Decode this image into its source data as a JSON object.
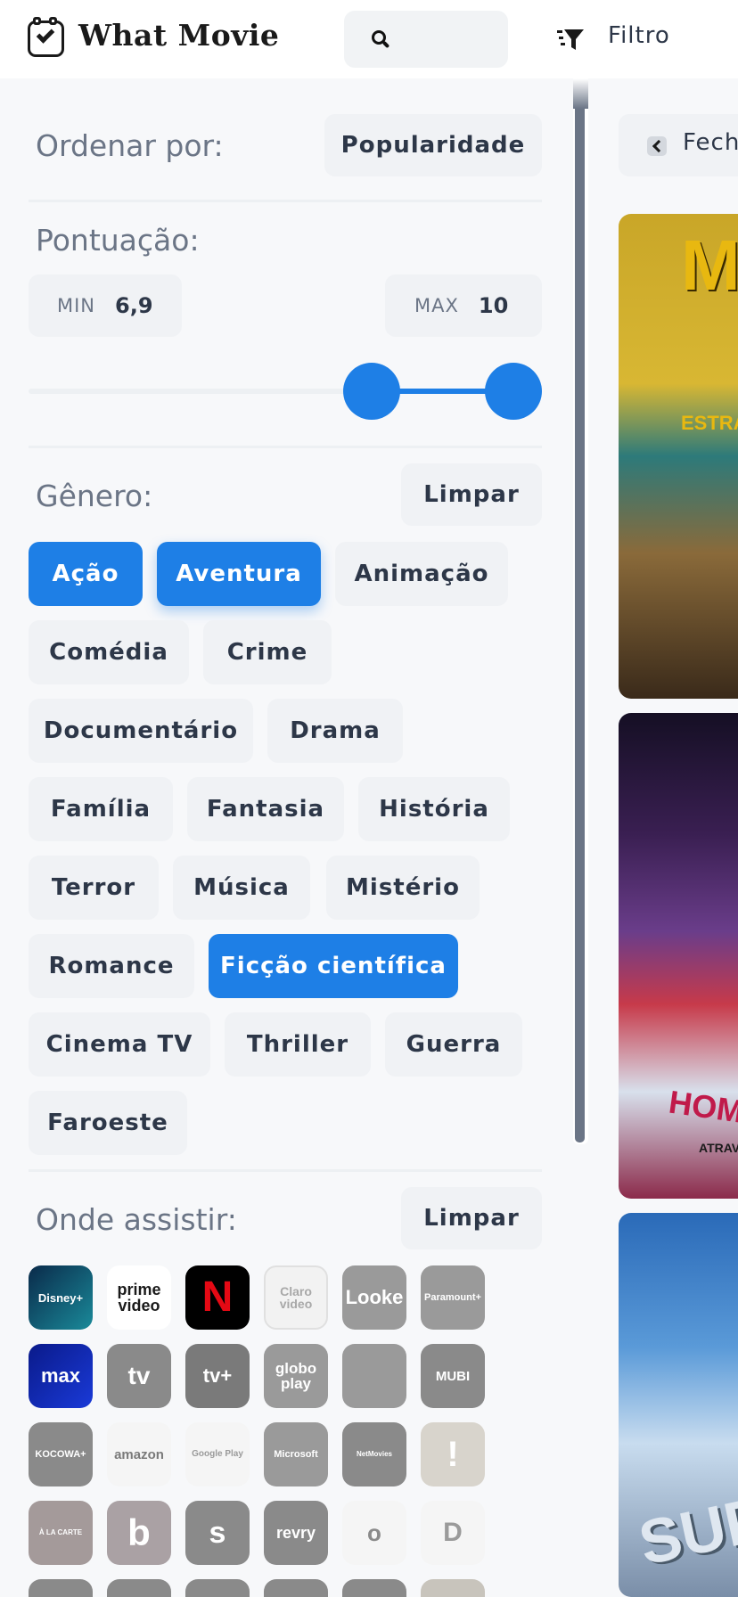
{
  "header": {
    "app_title": "What Movie",
    "filter_label": "Filtro"
  },
  "sort": {
    "label": "Ordenar por:",
    "selected": "Popularidade"
  },
  "score": {
    "label": "Pontuação:",
    "min_label": "MIN",
    "min_value": "6,9",
    "max_label": "MAX",
    "max_value": "10",
    "slider_min": 6.9,
    "slider_max": 10,
    "slider_scale_max": 10
  },
  "genre": {
    "label": "Gênero:",
    "clear_label": "Limpar",
    "items": [
      {
        "label": "Ação",
        "selected": true
      },
      {
        "label": "Aventura",
        "selected": true
      },
      {
        "label": "Animação",
        "selected": false
      },
      {
        "label": "Comédia",
        "selected": false
      },
      {
        "label": "Crime",
        "selected": false
      },
      {
        "label": "Documentário",
        "selected": false
      },
      {
        "label": "Drama",
        "selected": false
      },
      {
        "label": "Família",
        "selected": false
      },
      {
        "label": "Fantasia",
        "selected": false
      },
      {
        "label": "História",
        "selected": false
      },
      {
        "label": "Terror",
        "selected": false
      },
      {
        "label": "Música",
        "selected": false
      },
      {
        "label": "Mistério",
        "selected": false
      },
      {
        "label": "Romance",
        "selected": false
      },
      {
        "label": "Ficção científica",
        "selected": true
      },
      {
        "label": "Cinema TV",
        "selected": false
      },
      {
        "label": "Thriller",
        "selected": false
      },
      {
        "label": "Guerra",
        "selected": false
      },
      {
        "label": "Faroeste",
        "selected": false
      }
    ]
  },
  "providers": {
    "label": "Onde assistir:",
    "clear_label": "Limpar",
    "items": [
      {
        "name": "disney-plus",
        "text": "Disney+",
        "selected": true
      },
      {
        "name": "prime-video",
        "text": "prime video",
        "selected": true
      },
      {
        "name": "netflix",
        "text": "N",
        "selected": true
      },
      {
        "name": "claro-video",
        "text": "Claro video",
        "selected": false
      },
      {
        "name": "looke",
        "text": "Looke",
        "selected": false
      },
      {
        "name": "paramount-plus",
        "text": "Paramount+",
        "selected": false
      },
      {
        "name": "max",
        "text": "max",
        "selected": true
      },
      {
        "name": "apple-tv",
        "text": "tv",
        "selected": false
      },
      {
        "name": "apple-tv-plus",
        "text": "tv+",
        "selected": false
      },
      {
        "name": "globoplay",
        "text": "globo play",
        "selected": false
      },
      {
        "name": "crunchyroll",
        "text": "",
        "selected": false
      },
      {
        "name": "mubi",
        "text": "MUBI",
        "selected": false
      },
      {
        "name": "kocowa",
        "text": "KOCOWA+",
        "selected": false
      },
      {
        "name": "amazon",
        "text": "amazon",
        "selected": false
      },
      {
        "name": "google-play",
        "text": "Google Play",
        "selected": false
      },
      {
        "name": "microsoft",
        "text": "Microsoft",
        "selected": false
      },
      {
        "name": "netmovies",
        "text": "NetMovies",
        "selected": false
      },
      {
        "name": "oldflix",
        "text": "!",
        "selected": false
      },
      {
        "name": "a-la-carte",
        "text": "À LA CARTE",
        "selected": false
      },
      {
        "name": "belas-artes",
        "text": "b",
        "selected": false
      },
      {
        "name": "sun-nxt",
        "text": "s",
        "selected": false
      },
      {
        "name": "revry",
        "text": "revry",
        "selected": false
      },
      {
        "name": "oi-play",
        "text": "o",
        "selected": false
      },
      {
        "name": "dekkoo",
        "text": "D",
        "selected": false
      }
    ]
  },
  "results": {
    "close_label": "Fechar",
    "posters": [
      {
        "name": "poster-mad-max",
        "text": "MAD MAX",
        "subtitle": "ESTRADA"
      },
      {
        "name": "poster-spider-verse",
        "text": "HOMEM",
        "subtitle": "ATRAVÉS"
      },
      {
        "name": "poster-superman",
        "text": "SUPERMAN",
        "subtitle": ""
      }
    ]
  },
  "colors": {
    "accent": "#1e7fe6",
    "chip_bg": "#f0f2f5",
    "label": "#6b7586"
  }
}
